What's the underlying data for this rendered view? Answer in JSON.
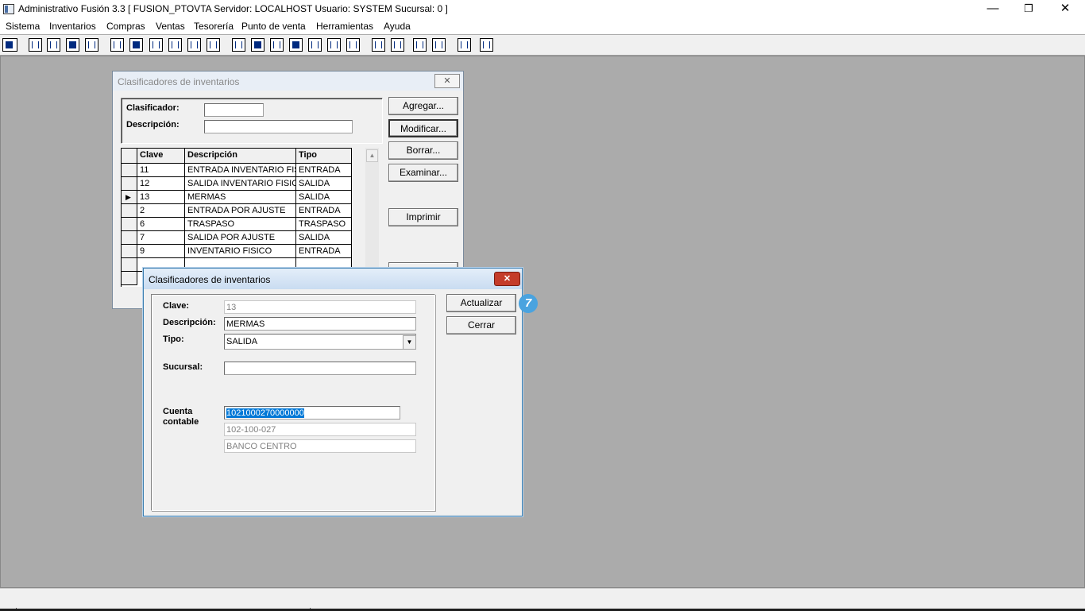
{
  "app": {
    "title": "Administrativo Fusión 3.3 [ FUSION_PTOVTA   Servidor: LOCALHOST   Usuario: SYSTEM    Sucursal: 0 ]",
    "minimize": "—",
    "restore": "❐",
    "close": "✕"
  },
  "menu": [
    "Sistema",
    "Inventarios",
    "Compras",
    "Ventas",
    "Tesorería",
    "Punto de venta",
    "Herramientas",
    "Ayuda"
  ],
  "main_window": {
    "title": "Clasificadores de inventarios",
    "close": "✕",
    "filter": {
      "clasificador_label": "Clasificador:",
      "clasificador_value": "",
      "descripcion_label": "Descripción:",
      "descripcion_value": ""
    },
    "buttons": {
      "agregar": "Agregar...",
      "modificar": "Modificar...",
      "borrar": "Borrar...",
      "examinar": "Examinar...",
      "imprimir": "Imprimir"
    },
    "grid": {
      "columns": [
        "Clave",
        "Descripción",
        "Tipo"
      ],
      "rows": [
        {
          "clave": "11",
          "descripcion": "ENTRADA INVENTARIO FISICO",
          "tipo": "ENTRADA"
        },
        {
          "clave": "12",
          "descripcion": "SALIDA INVENTARIO FISICO",
          "tipo": "SALIDA"
        },
        {
          "clave": "13",
          "descripcion": "MERMAS",
          "tipo": "SALIDA"
        },
        {
          "clave": "2",
          "descripcion": "ENTRADA POR AJUSTE",
          "tipo": "ENTRADA"
        },
        {
          "clave": "6",
          "descripcion": "TRASPASO",
          "tipo": "TRASPASO"
        },
        {
          "clave": "7",
          "descripcion": "SALIDA POR AJUSTE",
          "tipo": "SALIDA"
        },
        {
          "clave": "9",
          "descripcion": "INVENTARIO FISICO",
          "tipo": "ENTRADA"
        }
      ],
      "current_row_marker": "▶"
    }
  },
  "dialog": {
    "title": "Clasificadores de inventarios",
    "close": "✕",
    "clave_label": "Clave:",
    "clave_value": "13",
    "descripcion_label": "Descripción:",
    "descripcion_value": "MERMAS",
    "tipo_label": "Tipo:",
    "tipo_value": "SALIDA",
    "sucursal_label": "Sucursal:",
    "sucursal_value": "",
    "cuenta_label_1": "Cuenta",
    "cuenta_label_2": "contable",
    "cuenta_value": "1021000270000000",
    "cuenta_codigo": "102-100-027",
    "cuenta_nombre": "BANCO CENTRO",
    "actualizar": "Actualizar",
    "cerrar": "Cerrar",
    "step_badge": "7"
  },
  "colors": {
    "workspace": "#ababab",
    "selection": "#0078d7",
    "close_red": "#c43c2a",
    "badge": "#4aa3df"
  }
}
